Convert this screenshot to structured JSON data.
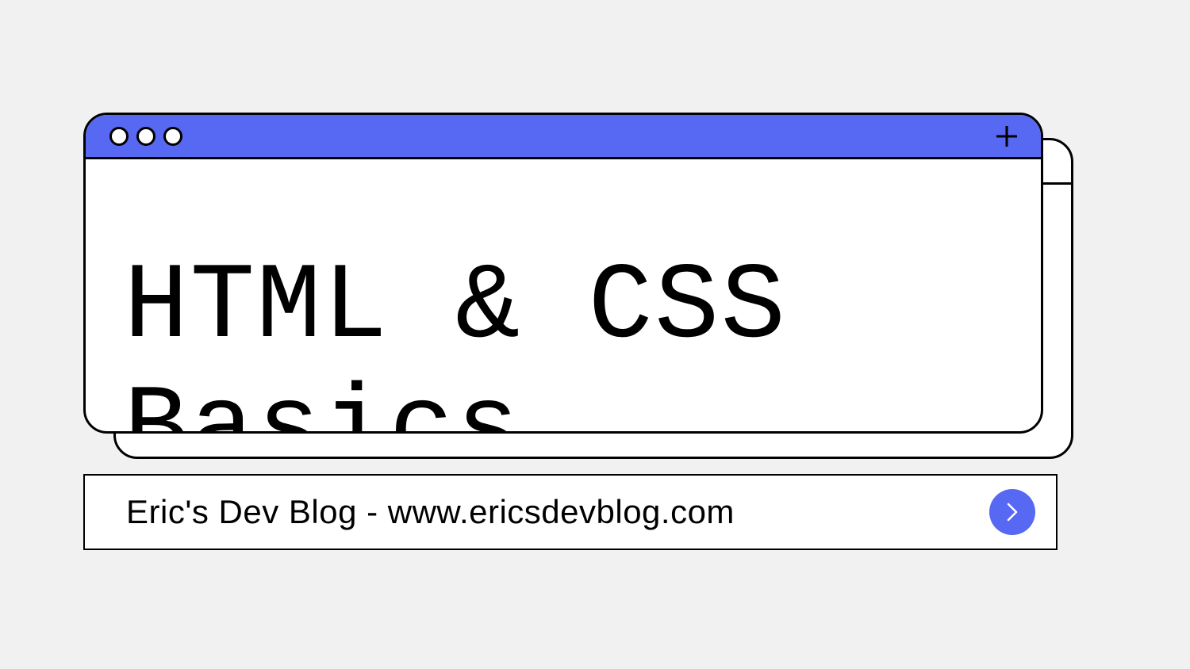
{
  "window": {
    "title": "HTML & CSS Basics"
  },
  "url_bar": {
    "text": "Eric's Dev Blog - www.ericsdevblog.com"
  },
  "colors": {
    "accent": "#5768f2",
    "background": "#f1f1f1",
    "border": "#000000"
  }
}
